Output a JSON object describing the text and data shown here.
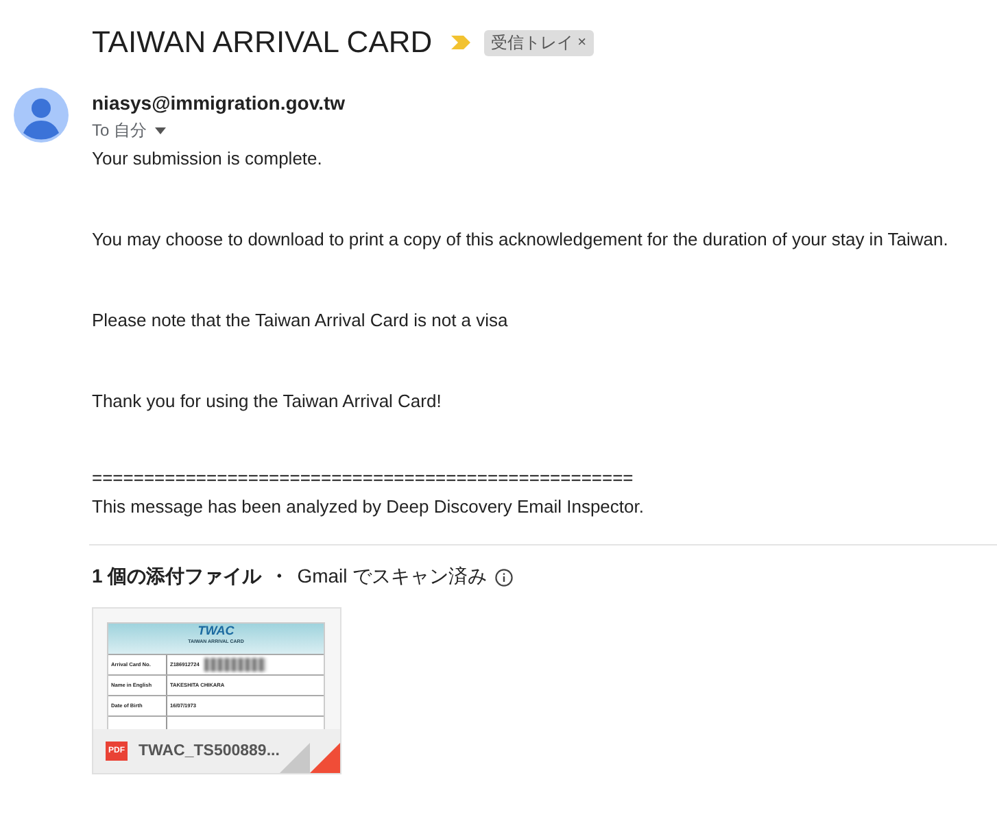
{
  "subject": "TAIWAN ARRIVAL CARD",
  "important": true,
  "label": {
    "text": "受信トレイ",
    "close": "×"
  },
  "sender": {
    "email": "niasys@immigration.gov.tw",
    "to": "To 自分"
  },
  "body": [
    "Your submission is complete.",
    "You may choose to download to print a copy of this acknowledgement for the duration of your stay in Taiwan.",
    "Please note that the Taiwan Arrival Card is not a visa",
    "Thank you for using the Taiwan Arrival Card!"
  ],
  "footer": {
    "rule": "====================================================",
    "note": "This message has been analyzed by Deep Discovery Email Inspector."
  },
  "attachments": {
    "count": "1 個の添付ファイル",
    "separator": "・",
    "scan": "Gmail でスキャン済み",
    "files": [
      {
        "badge": "PDF",
        "name": "TWAC_TS500889...",
        "preview": {
          "logo": "TWAC",
          "heading": "TAIWAN ARRIVAL CARD",
          "rows": [
            {
              "label": "Arrival Card No.",
              "value": "Z186912724"
            },
            {
              "label": "Name in English",
              "value": "TAKESHITA CHIKARA"
            },
            {
              "label": "Date of Birth",
              "value": "16/07/1973"
            }
          ]
        }
      }
    ]
  }
}
